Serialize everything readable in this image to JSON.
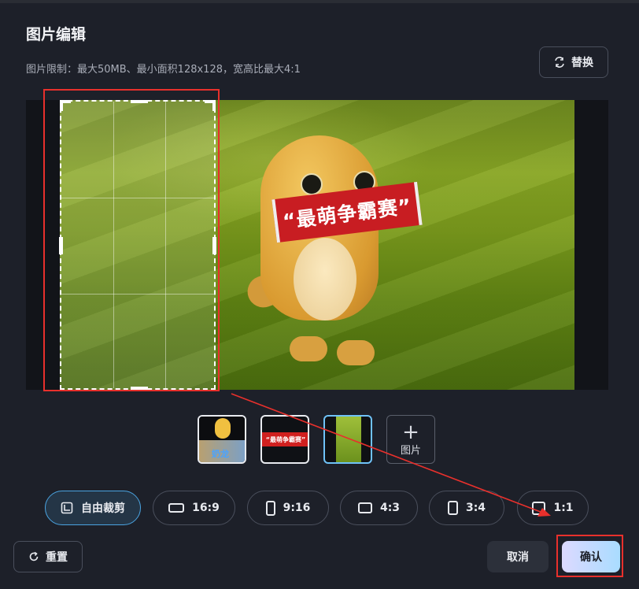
{
  "dialog": {
    "title": "图片编辑",
    "hint": "图片限制：最大50MB、最小面积128x128，宽高比最大4:1",
    "replace_label": "替换"
  },
  "image": {
    "banner_text": "“最萌争霸赛”"
  },
  "thumbnails": [
    {
      "name": "thumb-collage",
      "caption": "奶龙"
    },
    {
      "name": "thumb-banner",
      "caption": "“最萌争霸赛”"
    },
    {
      "name": "thumb-cropped",
      "caption": ""
    }
  ],
  "add_image_label": "图片",
  "ratios": [
    {
      "label": "自由裁剪",
      "icon": "free-crop-icon",
      "active": true
    },
    {
      "label": "16:9",
      "icon": "rect-landscape-icon"
    },
    {
      "label": "9:16",
      "icon": "rect-portrait-icon"
    },
    {
      "label": "4:3",
      "icon": "rect-landscape-icon"
    },
    {
      "label": "3:4",
      "icon": "rect-portrait-icon"
    },
    {
      "label": "1:1",
      "icon": "square-icon"
    }
  ],
  "footer": {
    "reset_label": "重置",
    "cancel_label": "取消",
    "confirm_label": "确认"
  },
  "colors": {
    "background": "#1d2029",
    "accent": "#4aa3e0",
    "annotation_red": "#e8302c"
  }
}
